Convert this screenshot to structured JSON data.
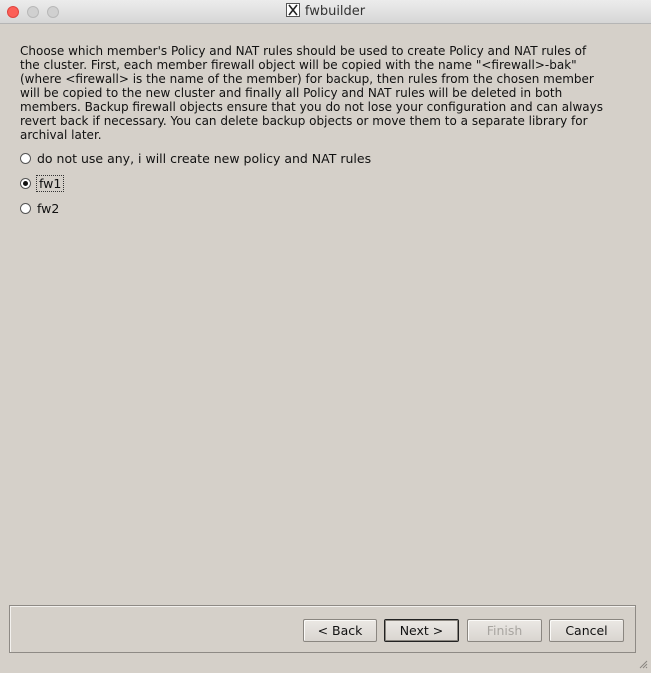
{
  "window": {
    "title": "fwbuilder",
    "app_icon": "x11-icon",
    "controls": [
      "close",
      "minimize",
      "maximize"
    ]
  },
  "description": "Choose which member's Policy and NAT rules should be used to create Policy and NAT rules of\nthe cluster. First, each member firewall object will be copied with the name \"<firewall>-bak\"\n(where <firewall> is the name of the member) for backup, then rules from the chosen member\nwill be copied to the new cluster and finally all Policy and NAT rules will be deleted in both\nmembers. Backup firewall objects ensure that you do not lose your configuration and can always\nrevert back if necessary. You can delete backup objects or move them to a separate library for\narchival later.",
  "options": [
    {
      "label": "do not use any, i will create new policy and NAT rules",
      "selected": false
    },
    {
      "label": "fw1",
      "selected": true
    },
    {
      "label": "fw2",
      "selected": false
    }
  ],
  "buttons": {
    "back": "< Back",
    "next": "Next >",
    "finish": "Finish",
    "cancel": "Cancel"
  }
}
